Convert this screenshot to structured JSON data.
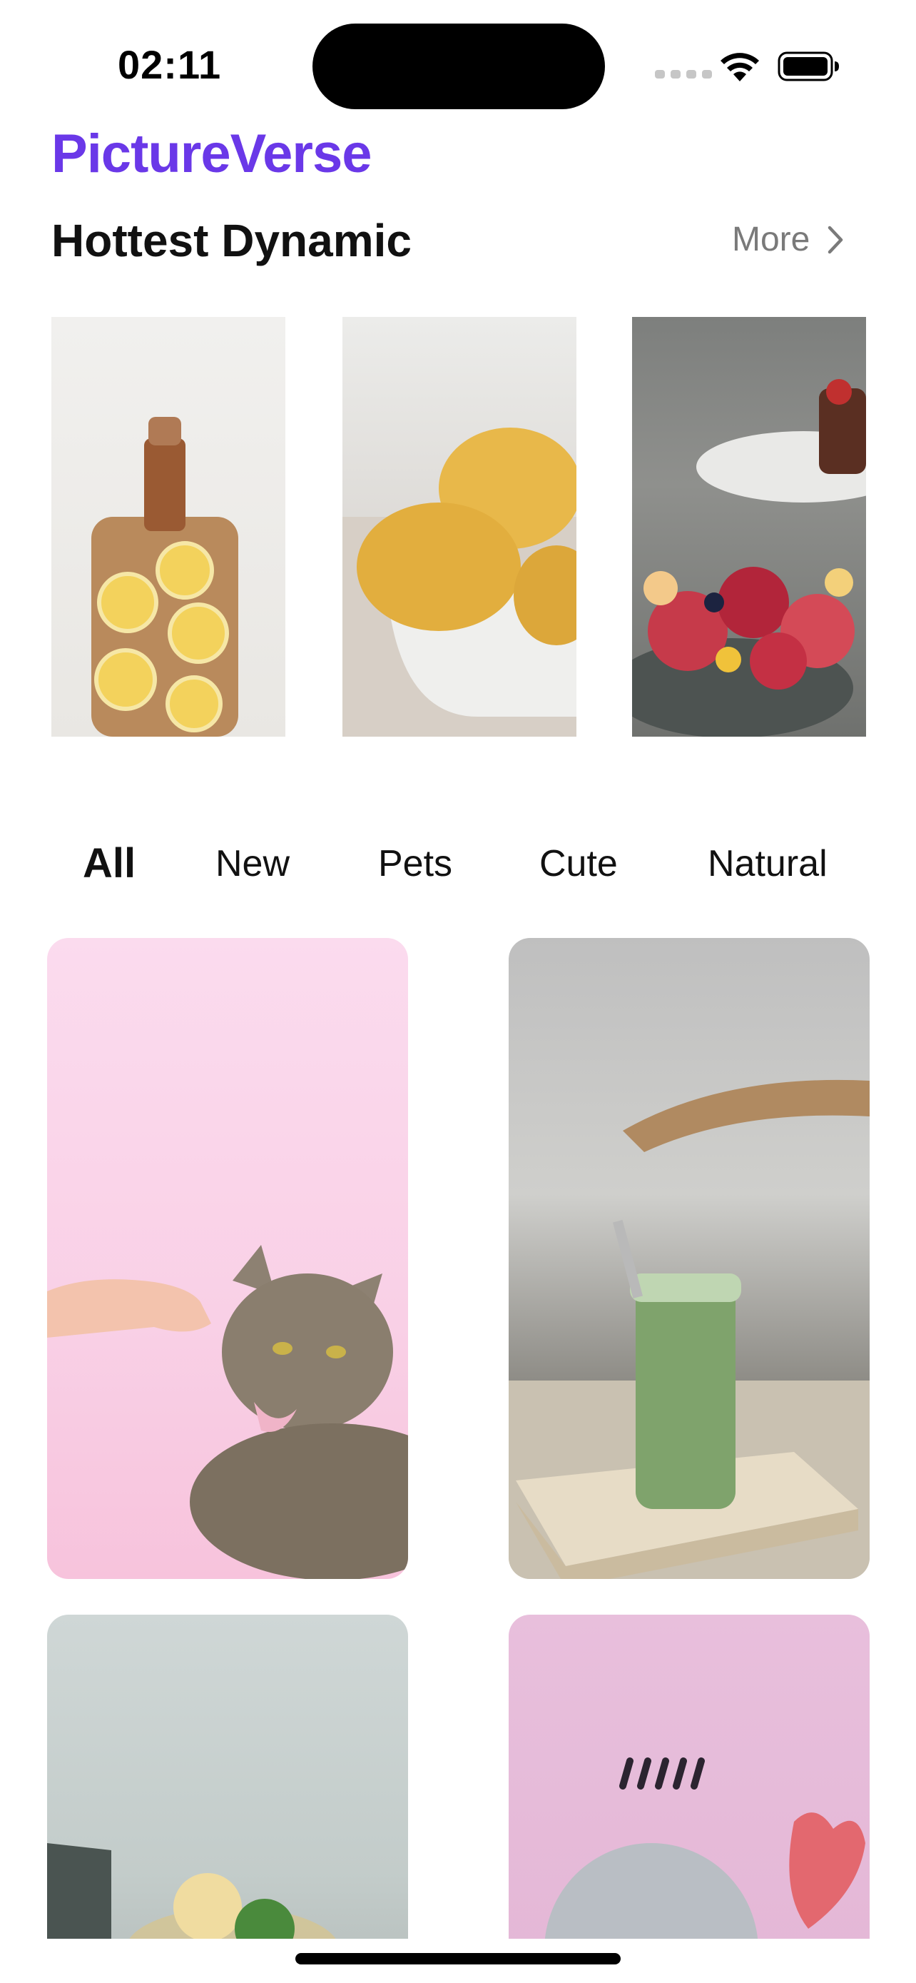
{
  "status_bar": {
    "time": "02:11"
  },
  "header": {
    "app_title": "PictureVerse"
  },
  "hottest": {
    "title": "Hottest Dynamic",
    "more_label": "More",
    "images": [
      "lemons-on-cutting-board-photo",
      "lemons-in-bowl-photo",
      "fruit-bowl-photo"
    ]
  },
  "tabs": [
    {
      "label": "All",
      "active": true
    },
    {
      "label": "New",
      "active": false
    },
    {
      "label": "Pets",
      "active": false
    },
    {
      "label": "Cute",
      "active": false
    },
    {
      "label": "Natural",
      "active": false
    }
  ],
  "grid": [
    "cat-pink-background-photo",
    "green-smoothie-photo",
    "lemon-drink-photo",
    "pink-dessert-photo"
  ],
  "colors": {
    "brand": "#6a38e8",
    "muted": "#7a7a7a"
  }
}
